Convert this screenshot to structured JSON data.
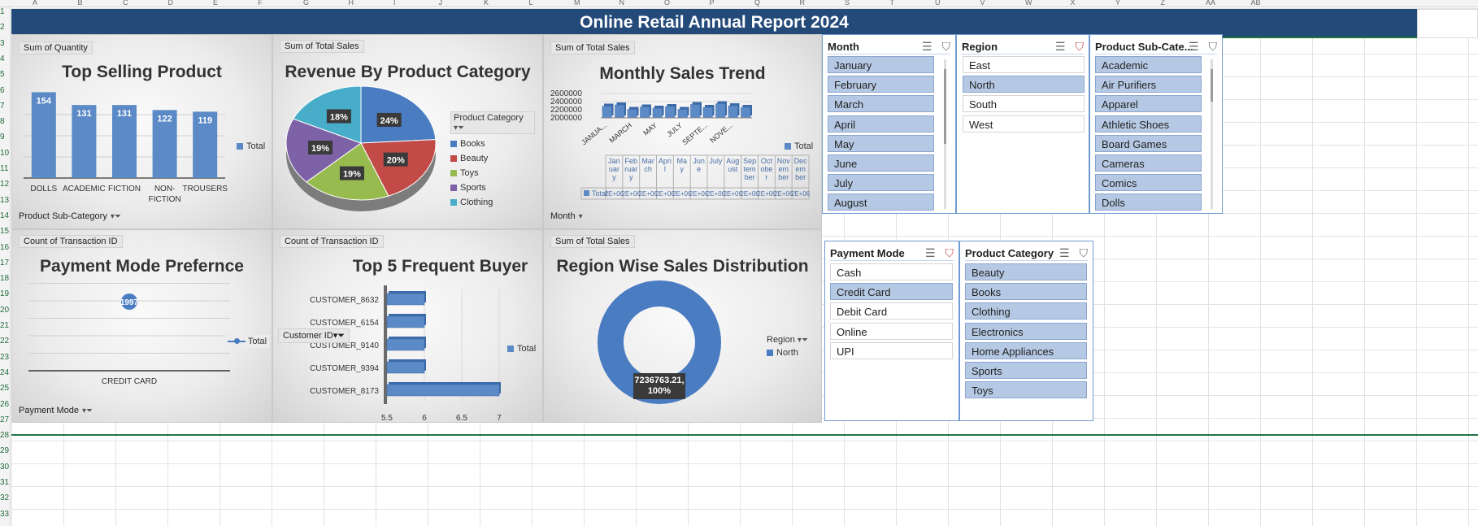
{
  "sheet": {
    "columns": [
      "A",
      "B",
      "C",
      "D",
      "E",
      "F",
      "G",
      "H",
      "I",
      "J",
      "K",
      "L",
      "M",
      "N",
      "O",
      "P",
      "Q",
      "R",
      "S",
      "T",
      "U",
      "V",
      "W",
      "X",
      "Y",
      "Z",
      "AA",
      "AB"
    ],
    "rows": [
      "1",
      "2",
      "3",
      "4",
      "5",
      "6",
      "7",
      "8",
      "9",
      "10",
      "11",
      "12",
      "13",
      "14",
      "15",
      "16",
      "17",
      "18",
      "19",
      "20",
      "21",
      "22",
      "23",
      "24",
      "25",
      "26",
      "27",
      "28",
      "29",
      "30",
      "31",
      "32",
      "33"
    ]
  },
  "title": "Online Retail Annual Report 2024",
  "charts": {
    "top_selling": {
      "field_value": "Sum of Quantity",
      "title": "Top Selling Product",
      "legend": "Total",
      "filter": "Product Sub-Category"
    },
    "revenue_category": {
      "field_value": "Sum of Total Sales",
      "title": "Revenue By Product Category",
      "legend_title": "Product Category",
      "legend_items": [
        {
          "label": "Books",
          "color": "#4a7cc2"
        },
        {
          "label": "Beauty",
          "color": "#c24b48"
        },
        {
          "label": "Toys",
          "color": "#98bb4f"
        },
        {
          "label": "Sports",
          "color": "#7e62a7"
        },
        {
          "label": "Clothing",
          "color": "#47adc9"
        }
      ]
    },
    "monthly_trend": {
      "field_value": "Sum of Total Sales",
      "title": "Monthly Sales Trend",
      "legend": "Total",
      "filter": "Month",
      "table_row_label": "Total",
      "table_cell_value": "2E+06",
      "table_headers": [
        "Jan uar y",
        "Feb ruar y",
        "Mar ch",
        "Apri l",
        "Ma y",
        "Jun e",
        "July",
        "Aug ust",
        "Sep tem ber",
        "Oct obe r",
        "Nov em ber",
        "Dec em ber"
      ]
    },
    "payment_mode": {
      "field_value": "Count of Transaction ID",
      "title": "Payment Mode Prefernce",
      "legend": "Total",
      "filter": "Payment Mode"
    },
    "frequent_buyer": {
      "field_value": "Count of Transaction ID",
      "title": "Top 5 Frequent Buyer",
      "legend": "Total",
      "filter": "Customer ID"
    },
    "region_dist": {
      "field_value": "Sum of Total Sales",
      "title": "Region Wise Sales Distribution",
      "legend_title": "Region",
      "legend_item": "North",
      "data_label_line1": "7236763.21,",
      "data_label_line2": "100%"
    }
  },
  "chart_data": [
    {
      "type": "bar",
      "title": "Top Selling Product",
      "categories": [
        "DOLLS",
        "ACADEMIC",
        "FICTION",
        "NON-FICTION",
        "TROUSERS"
      ],
      "series": [
        {
          "name": "Total",
          "values": [
            154,
            131,
            131,
            122,
            119
          ]
        }
      ],
      "color": "#5b8ac6"
    },
    {
      "type": "pie",
      "title": "Revenue By Product Category",
      "categories": [
        "Books",
        "Beauty",
        "Toys",
        "Sports",
        "Clothing"
      ],
      "values": [
        24,
        20,
        19,
        19,
        18
      ],
      "labels": [
        "24%",
        "20%",
        "19%",
        "19%",
        "18%"
      ]
    },
    {
      "type": "bar",
      "title": "Monthly Sales Trend",
      "categories": [
        "JANUA...",
        "FEBRUARY",
        "MARCH",
        "APRIL",
        "MAY",
        "JUNE",
        "JULY",
        "AUGUST",
        "SEPTE...",
        "OCTOBER",
        "NOVE...",
        "DECEMBER"
      ],
      "tick_labels": [
        "JANUA...",
        "MARCH",
        "MAY",
        "JULY",
        "SEPTE...",
        "NOVE..."
      ],
      "series": [
        {
          "name": "Total",
          "values": [
            2290000,
            2320000,
            2210000,
            2270000,
            2240000,
            2280000,
            2210000,
            2330000,
            2260000,
            2350000,
            2300000,
            2260000
          ]
        }
      ],
      "y_ticks": [
        "2600000",
        "2400000",
        "2200000",
        "2000000"
      ],
      "ylim": [
        2000000,
        2600000
      ]
    },
    {
      "type": "line",
      "title": "Payment Mode Prefernce",
      "categories": [
        "CREDIT CARD"
      ],
      "series": [
        {
          "name": "Total",
          "values": [
            1997
          ]
        }
      ]
    },
    {
      "type": "bar",
      "title": "Top 5 Frequent Buyer",
      "categories": [
        "CUSTOMER_8632",
        "CUSTOMER_6154",
        "CUSTOMER_9140",
        "CUSTOMER_9394",
        "CUSTOMER_8173"
      ],
      "series": [
        {
          "name": "Total",
          "values": [
            6,
            6,
            6,
            6,
            7
          ]
        }
      ],
      "x_ticks": [
        "5.5",
        "6",
        "6.5",
        "7"
      ],
      "xlim": [
        5.5,
        7
      ]
    },
    {
      "type": "pie",
      "title": "Region Wise Sales Distribution",
      "categories": [
        "North"
      ],
      "values": [
        7236763.21
      ],
      "labels": [
        "7236763.21, 100%"
      ]
    }
  ],
  "slicers": {
    "month": {
      "title": "Month",
      "items": [
        {
          "label": "January",
          "selected": true
        },
        {
          "label": "February",
          "selected": true
        },
        {
          "label": "March",
          "selected": true
        },
        {
          "label": "April",
          "selected": true
        },
        {
          "label": "May",
          "selected": true
        },
        {
          "label": "June",
          "selected": true
        },
        {
          "label": "July",
          "selected": true
        },
        {
          "label": "August",
          "selected": true
        }
      ]
    },
    "region": {
      "title": "Region",
      "items": [
        {
          "label": "East",
          "selected": false
        },
        {
          "label": "North",
          "selected": true
        },
        {
          "label": "South",
          "selected": false
        },
        {
          "label": "West",
          "selected": false
        }
      ]
    },
    "sub_category": {
      "title": "Product Sub-Cate...",
      "items": [
        {
          "label": "Academic",
          "selected": true
        },
        {
          "label": "Air Purifiers",
          "selected": true
        },
        {
          "label": "Apparel",
          "selected": true
        },
        {
          "label": "Athletic Shoes",
          "selected": true
        },
        {
          "label": "Board Games",
          "selected": true
        },
        {
          "label": "Cameras",
          "selected": true
        },
        {
          "label": "Comics",
          "selected": true
        },
        {
          "label": "Dolls",
          "selected": true
        }
      ]
    },
    "payment_mode": {
      "title": "Payment Mode",
      "items": [
        {
          "label": "Cash",
          "selected": false
        },
        {
          "label": "Credit Card",
          "selected": true
        },
        {
          "label": "Debit Card",
          "selected": false
        },
        {
          "label": "Online",
          "selected": false
        },
        {
          "label": "UPI",
          "selected": false
        }
      ]
    },
    "product_category": {
      "title": "Product Category",
      "items": [
        {
          "label": "Beauty",
          "selected": true
        },
        {
          "label": "Books",
          "selected": true
        },
        {
          "label": "Clothing",
          "selected": true
        },
        {
          "label": "Electronics",
          "selected": true
        },
        {
          "label": "Home Appliances",
          "selected": true
        },
        {
          "label": "Sports",
          "selected": true
        },
        {
          "label": "Toys",
          "selected": true
        }
      ]
    }
  },
  "icons": {
    "multi_select": "multi-select-icon",
    "clear_filter": "clear-filter-icon",
    "filter_dropdown": "filter-dropdown-icon"
  }
}
